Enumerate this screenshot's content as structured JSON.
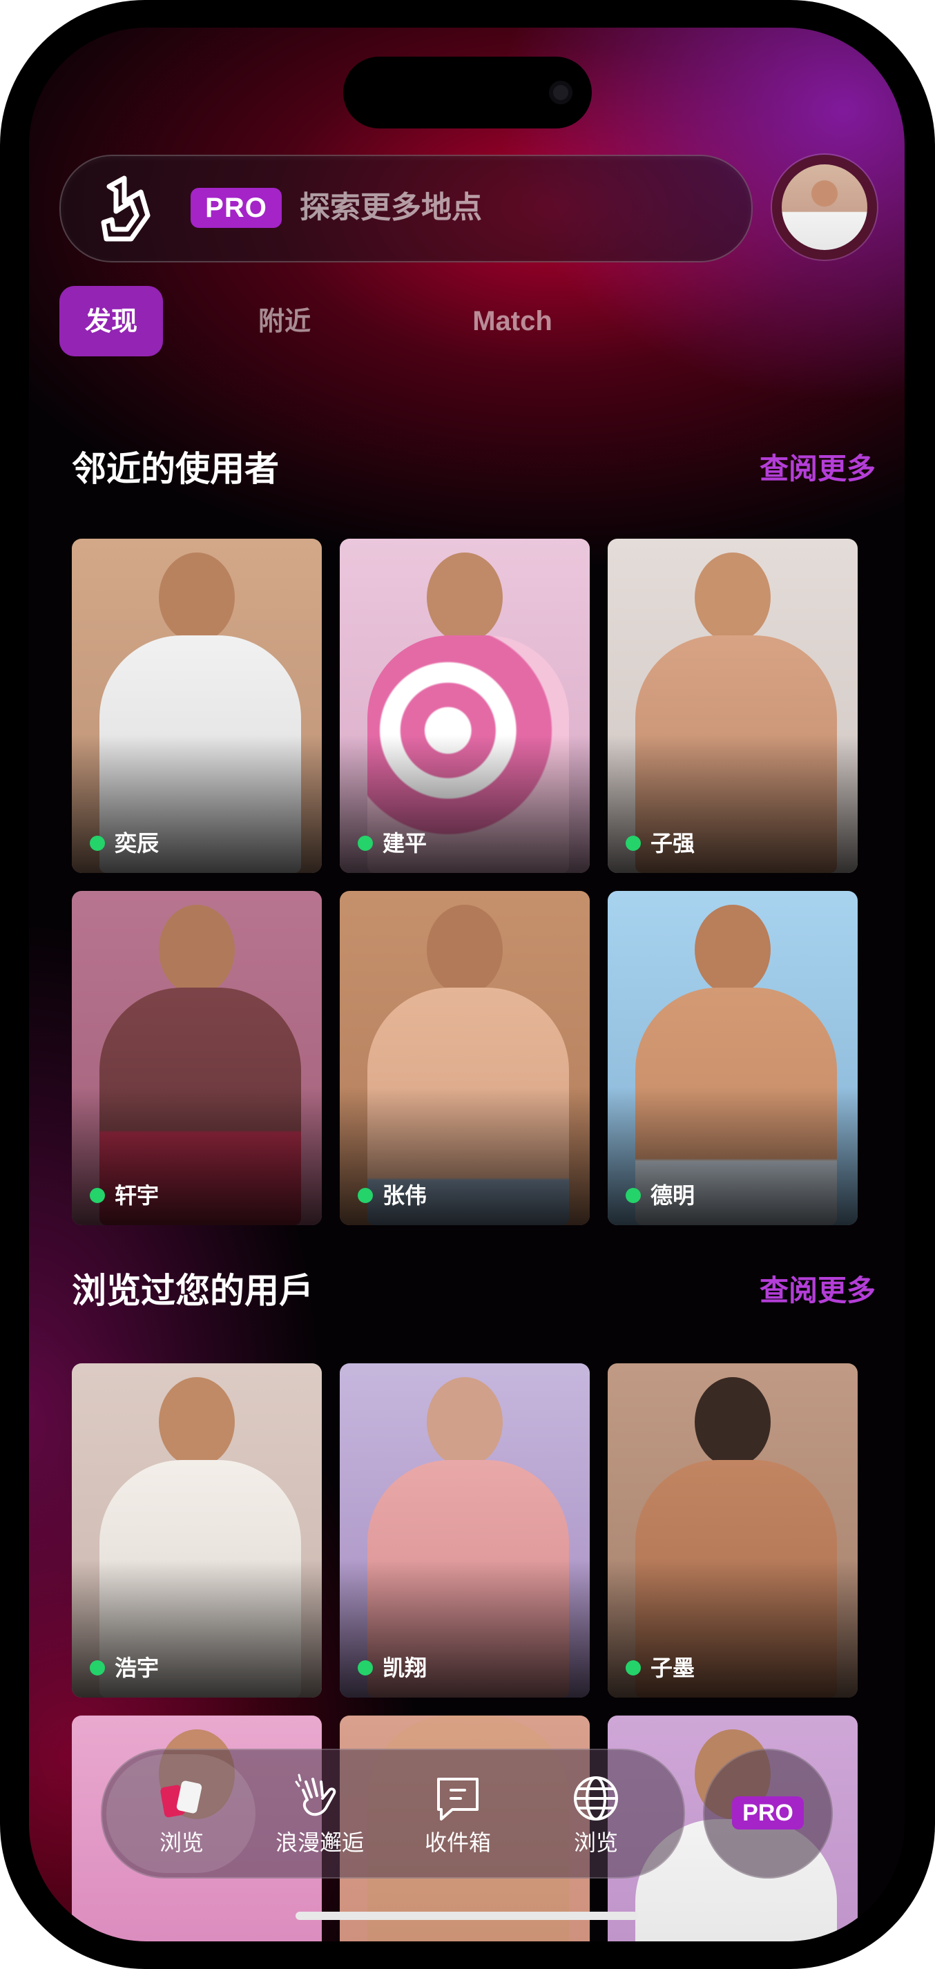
{
  "header": {
    "pro_badge": "PRO",
    "search_placeholder": "探索更多地点"
  },
  "tabs": [
    {
      "label": "发现",
      "active": true
    },
    {
      "label": "附近",
      "active": false
    },
    {
      "label": "Match",
      "active": false
    }
  ],
  "sections": {
    "nearby": {
      "title": "邻近的使用者",
      "see_more": "查阅更多",
      "users": [
        {
          "name": "奕辰",
          "online": true
        },
        {
          "name": "建平",
          "online": true
        },
        {
          "name": "子强",
          "online": true
        },
        {
          "name": "轩宇",
          "online": true
        },
        {
          "name": "张伟",
          "online": true
        },
        {
          "name": "德明",
          "online": true
        }
      ]
    },
    "viewed": {
      "title": "浏览过您的用戶",
      "see_more": "查阅更多",
      "users": [
        {
          "name": "浩宇",
          "online": true
        },
        {
          "name": "凯翔",
          "online": true
        },
        {
          "name": "子墨",
          "online": true
        }
      ]
    }
  },
  "tabbar": {
    "items": [
      {
        "label": "浏览",
        "icon": "cards-icon",
        "active": true
      },
      {
        "label": "浪漫邂逅",
        "icon": "wave-hand-icon",
        "active": false
      },
      {
        "label": "收件箱",
        "icon": "chat-icon",
        "active": false
      },
      {
        "label": "浏览",
        "icon": "globe-icon",
        "active": false
      }
    ],
    "pro_label": "PRO"
  },
  "colors": {
    "accent": "#a424c8",
    "see_more": "#b43ed8",
    "online": "#24d36a"
  }
}
